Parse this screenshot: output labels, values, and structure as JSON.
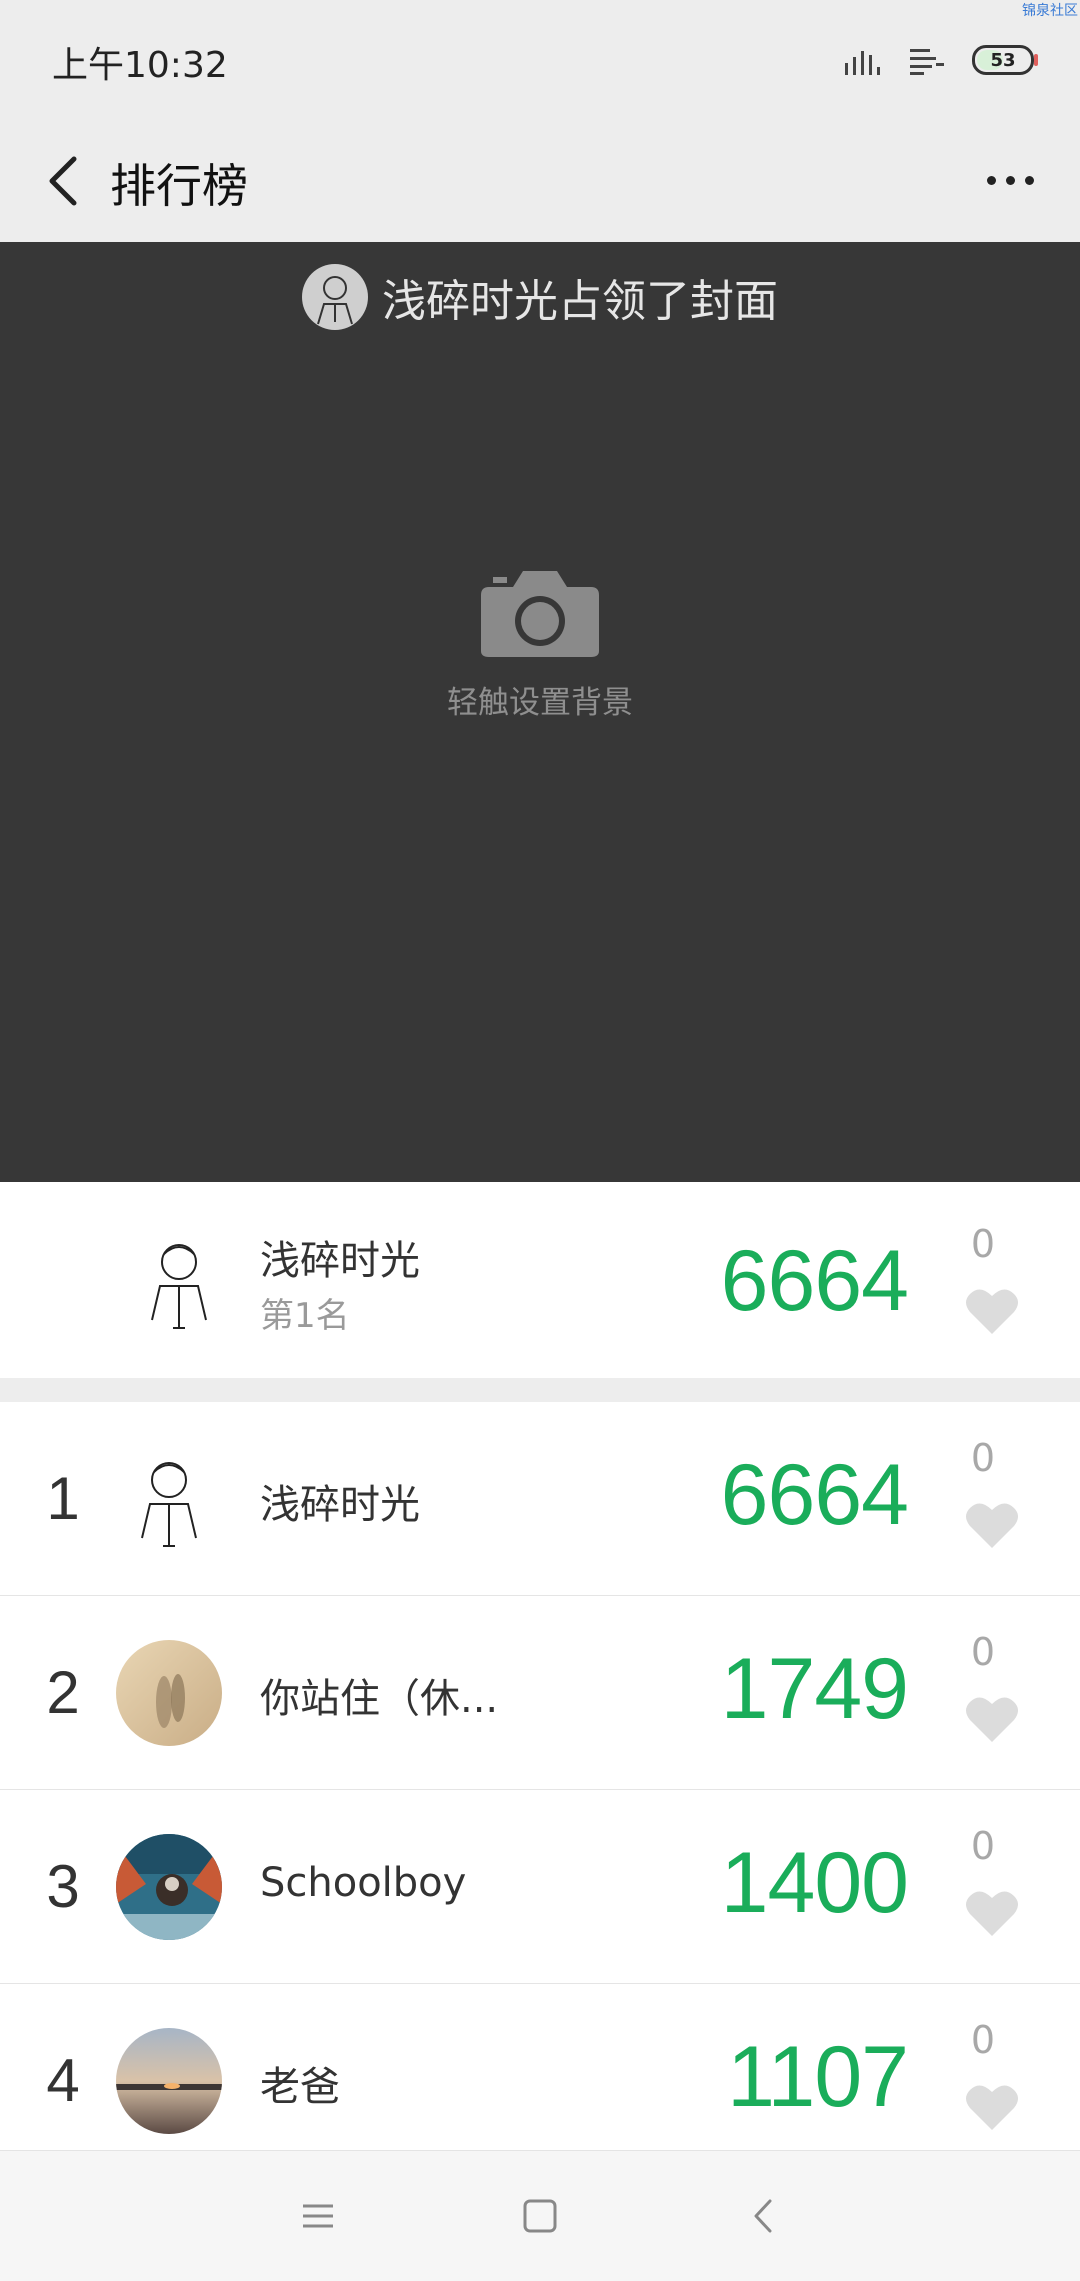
{
  "status": {
    "time": "上午10:32",
    "battery": "53",
    "watermark": "锦泉社区"
  },
  "nav": {
    "title": "排行榜"
  },
  "cover": {
    "owner_title": "浅碎时光占领了封面",
    "hint": "轻触设置背景"
  },
  "my_rank": {
    "name": "浅碎时光",
    "rank_label": "第1名",
    "steps": "6664",
    "likes": "0"
  },
  "rankings": [
    {
      "rank": "1",
      "name": "浅碎时光",
      "steps": "6664",
      "likes": "0"
    },
    {
      "rank": "2",
      "name": "你站住（休...",
      "steps": "1749",
      "likes": "0"
    },
    {
      "rank": "3",
      "name": "Schoolboy",
      "steps": "1400",
      "likes": "0"
    },
    {
      "rank": "4",
      "name": "老爸",
      "steps": "1107",
      "likes": "0"
    }
  ],
  "colors": {
    "accent": "#1aad5a",
    "cover_bg": "#373737",
    "bar_bg": "#ededed"
  },
  "icons": [
    "back-icon",
    "more-icon",
    "camera-icon",
    "heart-icon",
    "menu-icon",
    "home-icon",
    "back-nav-icon",
    "signal-icon",
    "battery-icon"
  ]
}
